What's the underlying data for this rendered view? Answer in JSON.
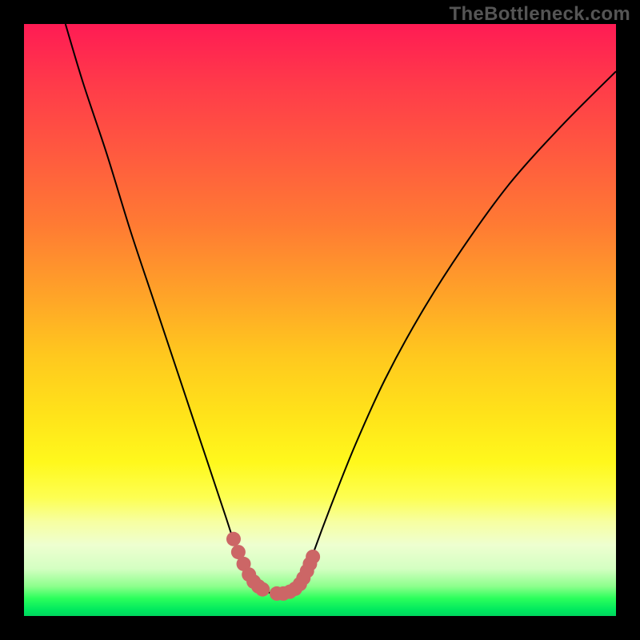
{
  "watermark": "TheBottleneck.com",
  "chart_data": {
    "type": "line",
    "title": "",
    "xlabel": "",
    "ylabel": "",
    "xlim": [
      0,
      100
    ],
    "ylim": [
      0,
      100
    ],
    "series": [
      {
        "name": "left-curve",
        "x": [
          7,
          10,
          14,
          18,
          22,
          26,
          28,
          30,
          32,
          34,
          35.5,
          37,
          38.6,
          40.2
        ],
        "values": [
          100,
          90,
          78,
          65,
          53,
          41,
          35,
          29,
          23,
          17,
          12.5,
          9,
          5.8,
          4.3
        ]
      },
      {
        "name": "right-curve",
        "x": [
          46.9,
          47.4,
          49,
          52,
          56,
          61,
          67,
          74,
          82,
          91,
          100
        ],
        "values": [
          4.3,
          6.3,
          11,
          19,
          29,
          40,
          51,
          62,
          73,
          83,
          92
        ]
      },
      {
        "name": "floor",
        "x": [
          40.2,
          43,
          46.9
        ],
        "values": [
          4.3,
          3.7,
          4.3
        ]
      }
    ],
    "markers": [
      {
        "name": "left-dots",
        "x": [
          35.4,
          36.2,
          37.1,
          38.0,
          38.8,
          39.6,
          40.3
        ],
        "y": [
          13.0,
          10.8,
          8.8,
          7.0,
          5.8,
          5.0,
          4.5
        ]
      },
      {
        "name": "right-dots",
        "x": [
          42.7,
          43.8,
          44.9,
          45.8,
          46.6,
          47.2,
          47.8,
          48.3,
          48.8
        ],
        "y": [
          3.8,
          3.8,
          4.1,
          4.6,
          5.4,
          6.4,
          7.6,
          8.8,
          10.0
        ]
      }
    ],
    "colors": {
      "curve": "#000000",
      "marker": "#cc6666",
      "gradient_top": "#ff1b54",
      "gradient_mid": "#ffe31a",
      "gradient_bottom": "#00d65e"
    }
  }
}
